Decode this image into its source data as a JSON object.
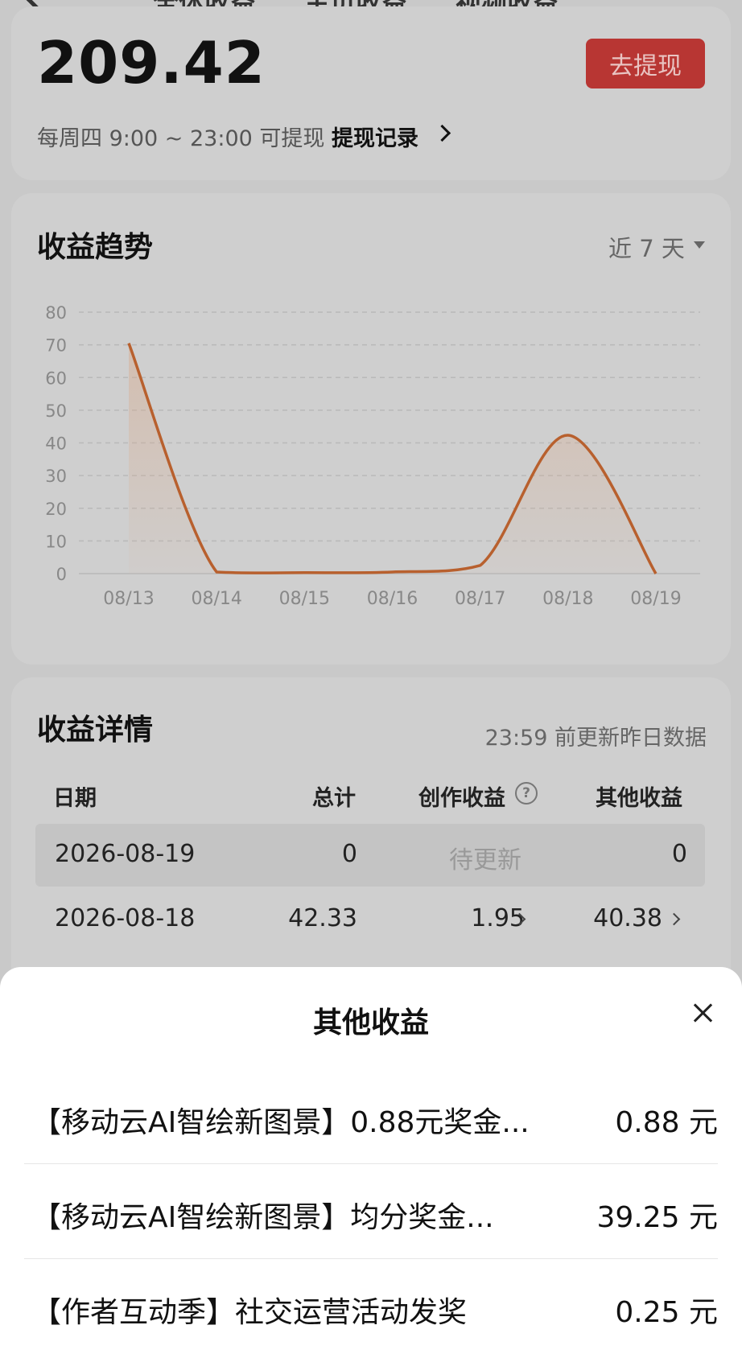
{
  "header": {
    "tabs": [
      "全体收益",
      "主页收益",
      "视频收益"
    ]
  },
  "balance": {
    "amount": "209.42",
    "withdraw_button": "去提现",
    "withdraw_note": "每周四 9:00 ~ 23:00 可提现",
    "withdraw_record": "提现记录"
  },
  "trend": {
    "title": "收益趋势",
    "range": "近 7 天",
    "chart_data": {
      "type": "line",
      "categories": [
        "08/13",
        "08/14",
        "08/15",
        "08/16",
        "08/17",
        "08/18",
        "08/19"
      ],
      "series": [
        {
          "values": [
            70.5,
            0.5,
            0.3,
            0.5,
            2.5,
            42.33,
            0
          ]
        }
      ],
      "y_ticks": [
        0,
        10,
        20,
        30,
        40,
        50,
        60,
        70,
        80
      ],
      "ylim": [
        0,
        80
      ],
      "grid": true,
      "line_color": "#b8602e"
    }
  },
  "details": {
    "title": "收益详情",
    "update_note": "23:59 前更新昨日数据",
    "columns": [
      "日期",
      "总计",
      "创作收益",
      "其他收益"
    ],
    "rows": [
      {
        "date": "2026-08-19",
        "total": "0",
        "creation": "待更新",
        "other": "0"
      },
      {
        "date": "2026-08-18",
        "total": "42.33",
        "creation": "1.95",
        "other": "40.38"
      }
    ]
  },
  "sheet": {
    "title": "其他收益",
    "items": [
      {
        "label": "【移动云AI智绘新图景】0.88元奖金...",
        "amount": "0.88 元"
      },
      {
        "label": "【移动云AI智绘新图景】均分奖金...",
        "amount": "39.25 元"
      },
      {
        "label": "【作者互动季】社交运营活动发奖",
        "amount": "0.25 元"
      }
    ]
  }
}
